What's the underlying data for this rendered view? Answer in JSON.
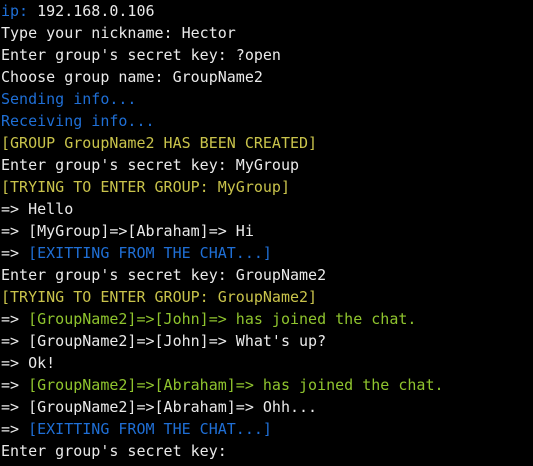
{
  "colors": {
    "background": "#000000",
    "default": "#eaeaea",
    "blue": "#1f6fd6",
    "yellow": "#c9c34b",
    "green": "#8fc42e"
  },
  "terminal": {
    "lines": [
      {
        "segments": [
          {
            "text": "ip: ",
            "color": "blue"
          },
          {
            "text": "192.168.0.106",
            "color": "default"
          }
        ]
      },
      {
        "segments": [
          {
            "text": "Type your nickname: Hector",
            "color": "default"
          }
        ]
      },
      {
        "segments": [
          {
            "text": "Enter group's secret key: ?open",
            "color": "default"
          }
        ]
      },
      {
        "segments": [
          {
            "text": "Choose group name: GroupName2",
            "color": "default"
          }
        ]
      },
      {
        "segments": [
          {
            "text": "Sending info...",
            "color": "blue"
          }
        ]
      },
      {
        "segments": [
          {
            "text": "Receiving info...",
            "color": "blue"
          }
        ]
      },
      {
        "segments": [
          {
            "text": "[GROUP GroupName2 HAS BEEN CREATED]",
            "color": "yellow"
          }
        ]
      },
      {
        "segments": [
          {
            "text": "Enter group's secret key: MyGroup",
            "color": "default"
          }
        ]
      },
      {
        "segments": [
          {
            "text": "[TRYING TO ENTER GROUP: MyGroup]",
            "color": "yellow"
          }
        ]
      },
      {
        "segments": [
          {
            "text": "=> Hello",
            "color": "default"
          }
        ]
      },
      {
        "segments": [
          {
            "text": "=> [MyGroup]=>[Abraham]=> Hi",
            "color": "default"
          }
        ]
      },
      {
        "segments": [
          {
            "text": "=> ",
            "color": "default"
          },
          {
            "text": "[EXITTING FROM THE CHAT...]",
            "color": "blue"
          }
        ]
      },
      {
        "segments": [
          {
            "text": "Enter group's secret key: GroupName2",
            "color": "default"
          }
        ]
      },
      {
        "segments": [
          {
            "text": "[TRYING TO ENTER GROUP: GroupName2]",
            "color": "yellow"
          }
        ]
      },
      {
        "segments": [
          {
            "text": "=> ",
            "color": "default"
          },
          {
            "text": "[GroupName2]=>[John]=> has joined the chat.",
            "color": "green"
          }
        ]
      },
      {
        "segments": [
          {
            "text": "=> [GroupName2]=>[John]=> What's up?",
            "color": "default"
          }
        ]
      },
      {
        "segments": [
          {
            "text": "=> Ok!",
            "color": "default"
          }
        ]
      },
      {
        "segments": [
          {
            "text": "=> ",
            "color": "default"
          },
          {
            "text": "[GroupName2]=>[Abraham]=> has joined the chat.",
            "color": "green"
          }
        ]
      },
      {
        "segments": [
          {
            "text": "=> [GroupName2]=>[Abraham]=> Ohh...",
            "color": "default"
          }
        ]
      },
      {
        "segments": [
          {
            "text": "=> ",
            "color": "default"
          },
          {
            "text": "[EXITTING FROM THE CHAT...]",
            "color": "blue"
          }
        ]
      },
      {
        "segments": [
          {
            "text": "Enter group's secret key:",
            "color": "default"
          }
        ]
      }
    ]
  }
}
